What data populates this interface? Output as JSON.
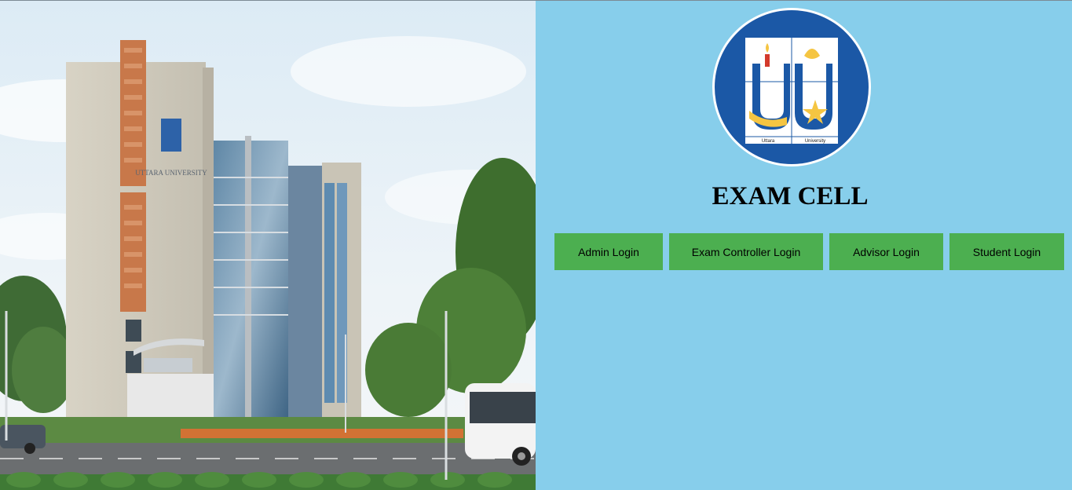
{
  "page": {
    "title": "EXAM CELL"
  },
  "hero": {
    "building_sign": "UTTARA UNIVERSITY"
  },
  "logo": {
    "text_left": "Uttara",
    "text_right": "University"
  },
  "buttons": {
    "admin": "Admin Login",
    "exam_controller": "Exam Controller Login",
    "advisor": "Advisor Login",
    "student": "Student Login"
  },
  "colors": {
    "panel_bg": "#87ceeb",
    "button_bg": "#4caf50",
    "logo_blue": "#1b58a6"
  }
}
